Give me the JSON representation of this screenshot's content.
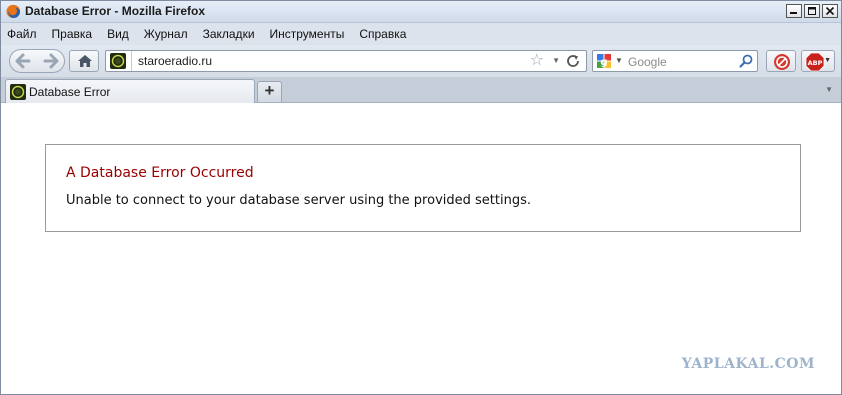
{
  "window": {
    "title": "Database Error - Mozilla Firefox"
  },
  "menu": {
    "items": [
      {
        "label": "Файл"
      },
      {
        "label": "Правка"
      },
      {
        "label": "Вид"
      },
      {
        "label": "Журнал"
      },
      {
        "label": "Закладки"
      },
      {
        "label": "Инструменты"
      },
      {
        "label": "Справка"
      }
    ]
  },
  "nav": {
    "url": "staroeradio.ru",
    "search_placeholder": "Google",
    "search_engine": "Google"
  },
  "tabs": [
    {
      "label": "Database Error",
      "active": true
    }
  ],
  "error": {
    "heading": "A Database Error Occurred",
    "message": "Unable to connect to your database server using the provided settings."
  },
  "watermark": "YAPLAKAL.COM",
  "colors": {
    "error_heading": "#990000",
    "error_border": "#999999",
    "watermark": "#9db3cc"
  },
  "icons": {
    "app": "firefox-icon",
    "back": "back-arrow-icon",
    "forward": "forward-arrow-icon",
    "home": "home-icon",
    "bookmark": "star-icon",
    "reload": "reload-icon",
    "search_engine": "google-icon",
    "search": "magnifier-icon",
    "addon": "addon-icon",
    "adblock": "adblock-plus-icon"
  }
}
